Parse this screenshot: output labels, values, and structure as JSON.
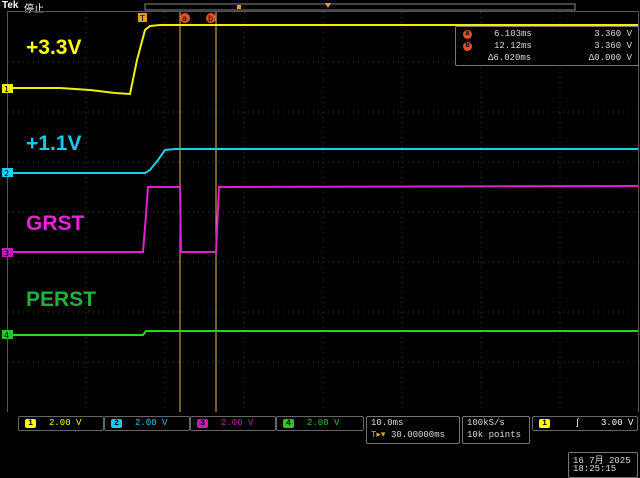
{
  "header": {
    "brand": "Tek",
    "status": "停止"
  },
  "channel_labels": [
    {
      "text": "+3.3V",
      "color": "#ffff00"
    },
    {
      "text": "+1.1V",
      "color": "#19c8f0"
    },
    {
      "text": "GRST",
      "color": "#f020d8"
    },
    {
      "text": "PERST",
      "color": "#20b040"
    }
  ],
  "channel_markers": [
    "1",
    "2",
    "3",
    "4"
  ],
  "cursor_markers": {
    "trigger": "T",
    "a": "a",
    "b": "b"
  },
  "cursor_readout": {
    "rows": [
      {
        "tag": "a",
        "time": "6.103ms",
        "value": "3.360 V"
      },
      {
        "tag": "b",
        "time": "12.12ms",
        "value": "3.360 V"
      }
    ],
    "delta_time": "Δ6.020ms",
    "delta_value": "Δ0.000 V"
  },
  "channels": [
    {
      "num": "1",
      "scale": "2.00 V",
      "color": "#ffff00"
    },
    {
      "num": "2",
      "scale": "2.00 V",
      "color": "#19c8f0"
    },
    {
      "num": "3",
      "scale": "2.00 V",
      "color": "#c020b0"
    },
    {
      "num": "4",
      "scale": "2.00 V",
      "color": "#30c030"
    }
  ],
  "timebase": {
    "scale": "10.0ms",
    "trigger_pos": "30.00000ms"
  },
  "acquisition": {
    "rate": "100kS/s",
    "record": "10k points"
  },
  "trigger": {
    "channel": "1",
    "level": "3.00 V"
  },
  "datetime": {
    "date": "16 7月  2025",
    "time": "18:25:15"
  },
  "colors": {
    "ch1": "#f0f000",
    "ch2": "#19d0f0",
    "ch3": "#e020d0",
    "ch4": "#30d030",
    "cursor": "#e0c050",
    "grid": "#444444"
  }
}
